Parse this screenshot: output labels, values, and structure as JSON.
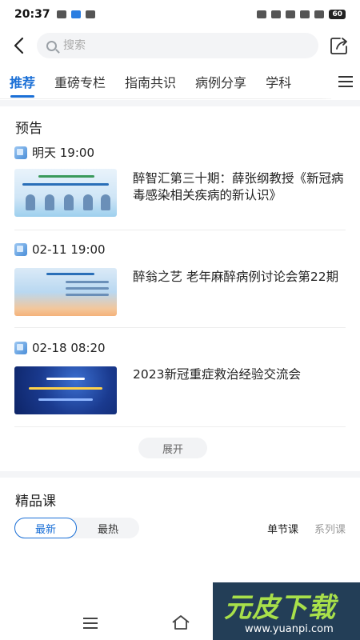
{
  "status": {
    "time": "20:37",
    "battery": "60"
  },
  "search": {
    "placeholder": "搜索"
  },
  "tabs": [
    {
      "label": "推荐",
      "active": true
    },
    {
      "label": "重磅专栏",
      "active": false
    },
    {
      "label": "指南共识",
      "active": false
    },
    {
      "label": "病例分享",
      "active": false
    },
    {
      "label": "学科",
      "active": false
    }
  ],
  "preview": {
    "title": "预告",
    "items": [
      {
        "time": "明天 19:00",
        "title": "醉智汇第三十期：薛张纲教授《新冠病毒感染相关疾病的新认识》"
      },
      {
        "time": "02-11 19:00",
        "title": "醉翁之艺 老年麻醉病例讨论会第22期"
      },
      {
        "time": "02-18 08:20",
        "title": "2023新冠重症救治经验交流会"
      }
    ],
    "expand_label": "展开"
  },
  "courses": {
    "title": "精品课",
    "segments": [
      {
        "label": "最新",
        "active": true
      },
      {
        "label": "最热",
        "active": false
      }
    ],
    "right_tabs": [
      {
        "label": "单节课",
        "active": true
      },
      {
        "label": "系列课",
        "active": false
      }
    ]
  },
  "watermark": {
    "text": "元皮下载",
    "url": "www.yuanpi.com"
  },
  "colors": {
    "accent": "#1a6fd6",
    "divider": "#f4f5f7"
  }
}
